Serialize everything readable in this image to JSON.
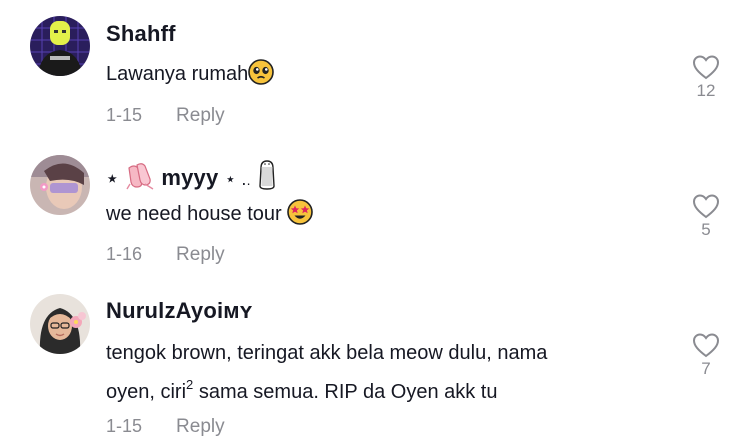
{
  "comments": [
    {
      "username": "Shahff",
      "text_parts": [
        "Lawanya rumah"
      ],
      "date": "1-15",
      "reply_label": "Reply",
      "likes": "12",
      "icons": [
        "pleading-face-emoji"
      ]
    },
    {
      "username_parts": [
        "⋆",
        "myyy",
        "⋆ .",
        "."
      ],
      "text": "we need house tour",
      "date": "1-16",
      "reply_label": "Reply",
      "likes": "5",
      "icons": [
        "ballet-shoes-emoji",
        "salt-shaker-emoji",
        "star-struck-emoji"
      ]
    },
    {
      "username": "NurulzAyoiᴍʏ",
      "text_line1": "tengok brown, teringat akk bela meow dulu, nama",
      "text_line2_a": "oyen, ciri",
      "text_line2_sup": "2",
      "text_line2_b": " sama semua. RIP da Oyen akk tu",
      "date": "1-15",
      "reply_label": "Reply",
      "likes": "7"
    }
  ],
  "colors": {
    "text": "#161823",
    "secondary": "#8a8b91",
    "background": "#ffffff"
  }
}
